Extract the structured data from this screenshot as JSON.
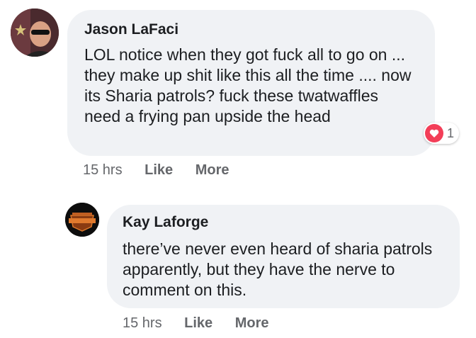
{
  "comments": [
    {
      "author": "Jason LaFaci",
      "text": "LOL notice when they got fuck all to go on ... they make up shit like this all the time .... now its Sharia patrols? fuck these twatwaffles need a frying pan upside the head",
      "time": "15 hrs",
      "like_label": "Like",
      "more_label": "More",
      "reaction_icon": "heart-icon",
      "reaction_count": "1",
      "reaction_color": "#f33e58"
    },
    {
      "author": "Kay Laforge",
      "text": "there’ve never even heard of sharia patrols apparently, but they have the nerve to comment on this.",
      "time": "15 hrs",
      "like_label": "Like",
      "more_label": "More"
    }
  ],
  "colors": {
    "bubble": "#f0f2f5",
    "meta_text": "#65676b"
  }
}
